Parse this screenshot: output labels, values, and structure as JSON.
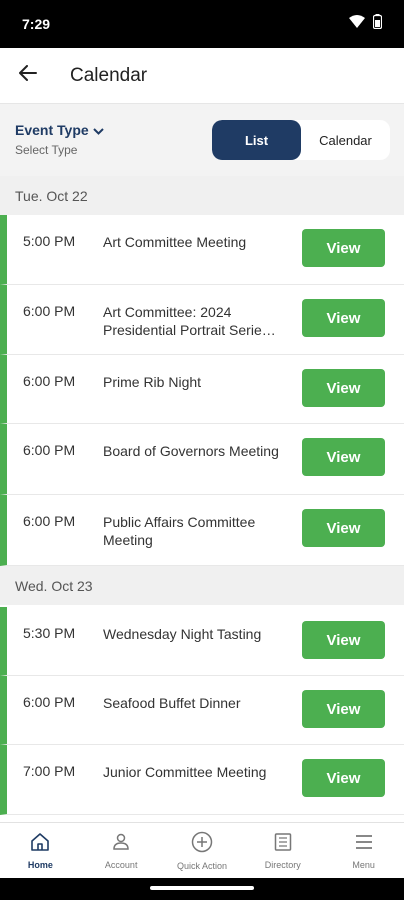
{
  "status_bar": {
    "time": "7:29"
  },
  "header": {
    "title": "Calendar"
  },
  "filter": {
    "event_type_label": "Event Type",
    "event_type_sub": "Select Type",
    "toggle": {
      "list": "List",
      "calendar": "Calendar",
      "active": "list"
    }
  },
  "sections": [
    {
      "date": "Tue. Oct 22",
      "events": [
        {
          "time": "5:00 PM",
          "title": "Art Committee Meeting",
          "action": "View"
        },
        {
          "time": "6:00 PM",
          "title": "Art Committee: 2024 Presidential Portrait Serie…",
          "action": "View"
        },
        {
          "time": "6:00 PM",
          "title": "Prime Rib Night",
          "action": "View"
        },
        {
          "time": "6:00 PM",
          "title": "Board  of Governors Meeting",
          "action": "View"
        },
        {
          "time": "6:00 PM",
          "title": "Public Affairs Committee Meeting",
          "action": "View"
        }
      ]
    },
    {
      "date": "Wed. Oct 23",
      "events": [
        {
          "time": "5:30 PM",
          "title": "Wednesday Night Tasting",
          "action": "View"
        },
        {
          "time": "6:00 PM",
          "title": "Seafood Buffet Dinner",
          "action": "View"
        },
        {
          "time": "7:00 PM",
          "title": "Junior Committee Meeting",
          "action": "View"
        }
      ]
    }
  ],
  "bottom_nav": [
    {
      "label": "Home",
      "icon": "home-icon",
      "active": true
    },
    {
      "label": "Account",
      "icon": "person-icon",
      "active": false
    },
    {
      "label": "Quick Action",
      "icon": "plus-circle-icon",
      "active": false
    },
    {
      "label": "Directory",
      "icon": "list-icon",
      "active": false
    },
    {
      "label": "Menu",
      "icon": "menu-icon",
      "active": false
    }
  ],
  "colors": {
    "accent": "#1f3b64",
    "green": "#4caf50"
  }
}
